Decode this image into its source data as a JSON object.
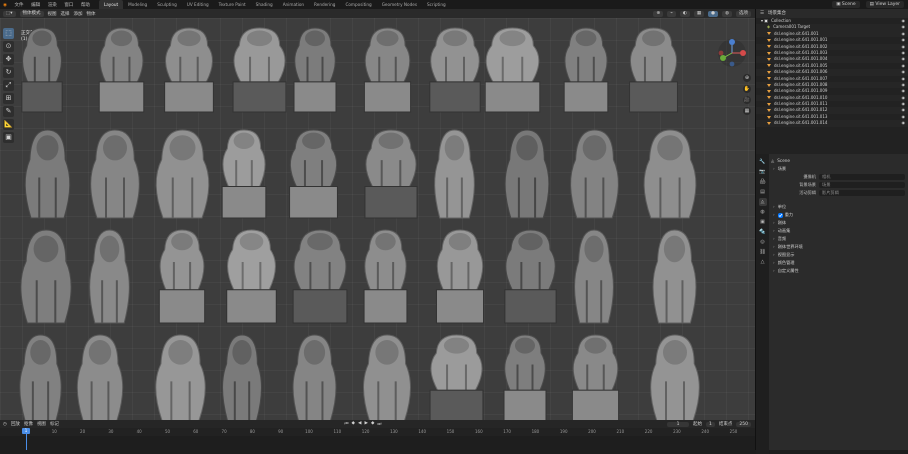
{
  "topbar": {
    "menu": [
      "文件",
      "编辑",
      "渲染",
      "窗口",
      "帮助"
    ],
    "workspaces": [
      "Layout",
      "Modeling",
      "Sculpting",
      "UV Editing",
      "Texture Paint",
      "Shading",
      "Animation",
      "Rendering",
      "Compositing",
      "Geometry Nodes",
      "Scripting"
    ],
    "active_workspace": "Layout",
    "scene": "Scene",
    "view_layer": "View Layer"
  },
  "viewport_header": {
    "mode": "物体模式",
    "menus": [
      "视图",
      "选择",
      "添加",
      "物体"
    ],
    "shading_label": "选项"
  },
  "viewport": {
    "title_line1": "正交前视图",
    "title_line2": "(1) Cabinet Flat"
  },
  "outliner": {
    "header": "场景集合",
    "collection": "Collection",
    "camera": "Camera001 Target",
    "items": [
      "dsl.engine.sit.641.001",
      "dsl.engine.sit.641.001.001",
      "dsl.engine.sit.641.001.002",
      "dsl.engine.sit.641.001.003",
      "dsl.engine.sit.641.001.004",
      "dsl.engine.sit.641.001.005",
      "dsl.engine.sit.641.001.006",
      "dsl.engine.sit.641.001.007",
      "dsl.engine.sit.641.001.008",
      "dsl.engine.sit.641.001.009",
      "dsl.engine.sit.641.001.010",
      "dsl.engine.sit.641.001.011",
      "dsl.engine.sit.641.001.012",
      "dsl.engine.sit.641.001.013",
      "dsl.engine.sit.641.001.014"
    ]
  },
  "properties": {
    "scene_name": "Scene",
    "section_scene": "场景",
    "camera_label": "摄像机",
    "camera_value": "相机",
    "bg_scene_label": "背景场景",
    "bg_scene_value": "场景",
    "active_clip_label": "活动剪辑",
    "active_clip_value": "影片剪辑",
    "sections": [
      "单位",
      "重力",
      "刚体",
      "动画集",
      "音频",
      "刚体世界环境",
      "视图显示",
      "颜色管理",
      "自定义属性"
    ]
  },
  "timeline": {
    "menus": [
      "回放",
      "抠像",
      "视图",
      "标记"
    ],
    "current_frame": "1",
    "start_label": "起始",
    "start": "1",
    "end_label": "结束点",
    "end": "250",
    "ticks": [
      "0",
      "10",
      "20",
      "30",
      "40",
      "50",
      "60",
      "70",
      "80",
      "90",
      "100",
      "110",
      "120",
      "130",
      "140",
      "150",
      "160",
      "170",
      "180",
      "190",
      "200",
      "210",
      "220",
      "230",
      "240",
      "250"
    ]
  },
  "colors": {
    "accent": "#4a8ee8",
    "object_icon": "#e8a040",
    "viewport_bg": "#3d3d3d"
  },
  "icons": [
    "cursor-icon",
    "move-icon",
    "rotate-icon",
    "scale-icon",
    "transform-icon",
    "annotate-icon",
    "measure-icon",
    "add-cube-icon",
    "eye-icon",
    "camera-icon",
    "play-icon"
  ]
}
